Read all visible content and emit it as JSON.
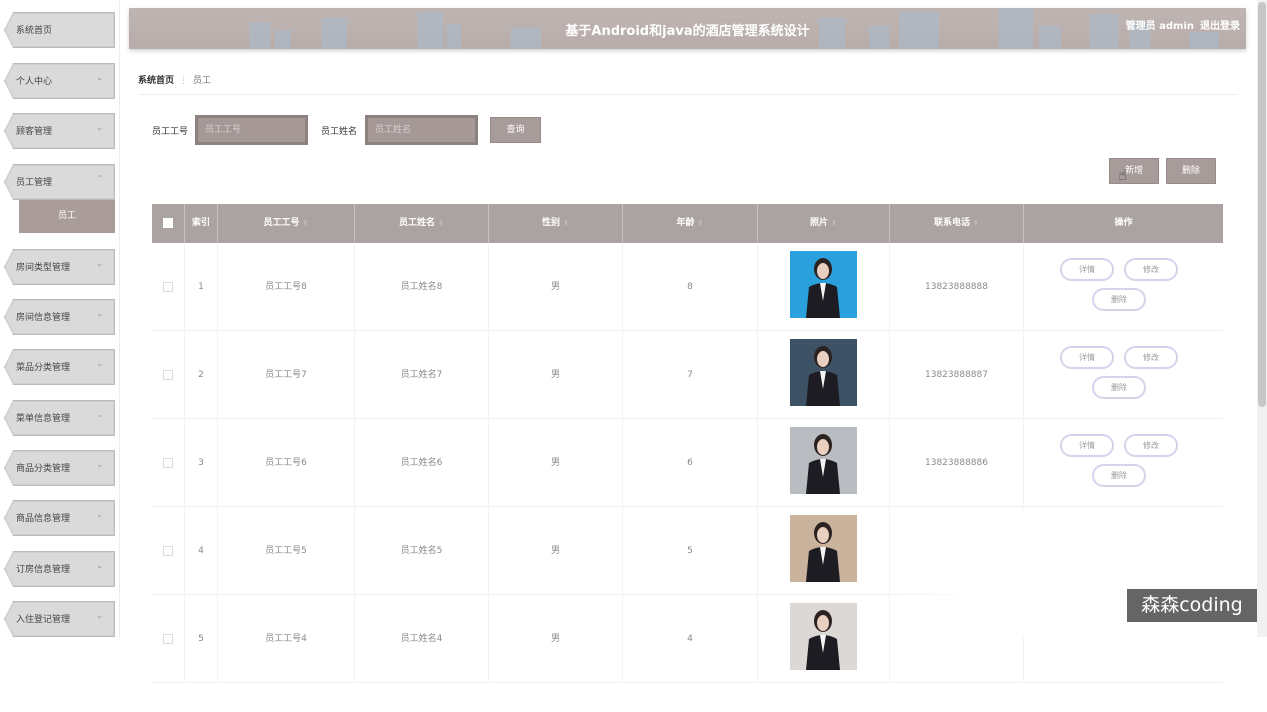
{
  "sidebar": {
    "items": [
      {
        "label": "系统首页",
        "chevron": ""
      },
      {
        "label": "个人中心",
        "chevron": "⌄"
      },
      {
        "label": "顾客管理",
        "chevron": "⌄"
      },
      {
        "label": "员工管理",
        "chevron": "⌃"
      },
      {
        "label": "房间类型管理",
        "chevron": "⌄"
      },
      {
        "label": "房间信息管理",
        "chevron": "⌄"
      },
      {
        "label": "菜品分类管理",
        "chevron": "⌄"
      },
      {
        "label": "菜单信息管理",
        "chevron": "⌄"
      },
      {
        "label": "商品分类管理",
        "chevron": "⌄"
      },
      {
        "label": "商品信息管理",
        "chevron": "⌄"
      },
      {
        "label": "订房信息管理",
        "chevron": "⌄"
      },
      {
        "label": "入住登记管理",
        "chevron": "⌄"
      }
    ],
    "sub_item": "员工"
  },
  "header": {
    "title": "基于Android和java的酒店管理系统设计",
    "user": "管理员 admin",
    "logout": "退出登录"
  },
  "breadcrumb": {
    "home": "系统首页",
    "sep": "⋮",
    "current": "员工"
  },
  "search": {
    "field1_label": "员工工号",
    "field1_placeholder": "员工工号",
    "field2_label": "员工姓名",
    "field2_placeholder": "员工姓名",
    "query_button": "查询"
  },
  "actions": {
    "add_button": "新增",
    "delete_button": "删除"
  },
  "table": {
    "columns": [
      "索引",
      "员工工号",
      "员工姓名",
      "性别",
      "年龄",
      "照片",
      "联系电话",
      "操作"
    ],
    "sort_glyph": "⇕",
    "rows": [
      {
        "index": "1",
        "id": "员工工号8",
        "name": "员工姓名8",
        "gender": "男",
        "age": "8",
        "phone": "13823888888",
        "photo_bg": "#2aa0dc"
      },
      {
        "index": "2",
        "id": "员工工号7",
        "name": "员工姓名7",
        "gender": "男",
        "age": "7",
        "phone": "13823888887",
        "photo_bg": "#3e5266"
      },
      {
        "index": "3",
        "id": "员工工号6",
        "name": "员工姓名6",
        "gender": "男",
        "age": "6",
        "phone": "13823888886",
        "photo_bg": "#b9bcc0"
      },
      {
        "index": "4",
        "id": "员工工号5",
        "name": "员工姓名5",
        "gender": "男",
        "age": "5",
        "phone": "",
        "photo_bg": "#c9b39c"
      },
      {
        "index": "5",
        "id": "员工工号4",
        "name": "员工姓名4",
        "gender": "男",
        "age": "4",
        "phone": "",
        "photo_bg": "#dcd8d6"
      }
    ],
    "ops": {
      "detail": "详情",
      "edit": "修改",
      "delete": "删除"
    }
  },
  "watermark": "森森coding",
  "colors": {
    "accent": "#a89c9a",
    "header": "#bdb3b0",
    "table_head": "#aba3a1",
    "op_border": "#d8d2ea"
  }
}
